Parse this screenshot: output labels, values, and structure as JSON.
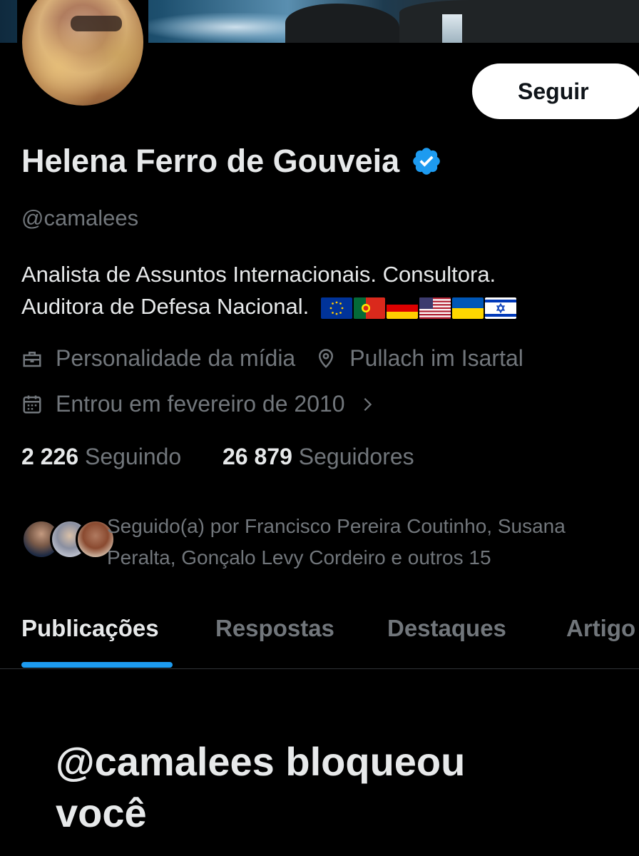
{
  "profile": {
    "follow_button": "Seguir",
    "name": "Helena Ferro de Gouveia",
    "handle": "@camalees",
    "bio_line1": "Analista de Assuntos Internacionais. Consultora.",
    "bio_line2": "Auditora de Defesa Nacional.",
    "flags": [
      "EU",
      "Portugal",
      "Germany",
      "USA",
      "Ukraine",
      "Israel"
    ],
    "category": "Personalidade da mídia",
    "location": "Pullach im Isartal",
    "joined": "Entrou em fevereiro de 2010",
    "following_count": "2 226",
    "following_label": "Seguindo",
    "followers_count": "26 879",
    "followers_label": "Seguidores",
    "followed_by_line1": "Seguido(a) por Francisco Pereira Coutinho, Susana",
    "followed_by_line2": "Peralta, Gonçalo Levy Cordeiro e outros 15"
  },
  "tabs": [
    {
      "label": "Publicações",
      "active": true
    },
    {
      "label": "Respostas",
      "active": false
    },
    {
      "label": "Destaques",
      "active": false
    },
    {
      "label": "Artigo",
      "active": false
    }
  ],
  "blocked_message_line1": "@camalees bloqueou",
  "blocked_message_line2": "você",
  "colors": {
    "accent": "#1d9bf0",
    "background": "#000000",
    "text_primary": "#e7e9ea",
    "text_secondary": "#71767b"
  }
}
